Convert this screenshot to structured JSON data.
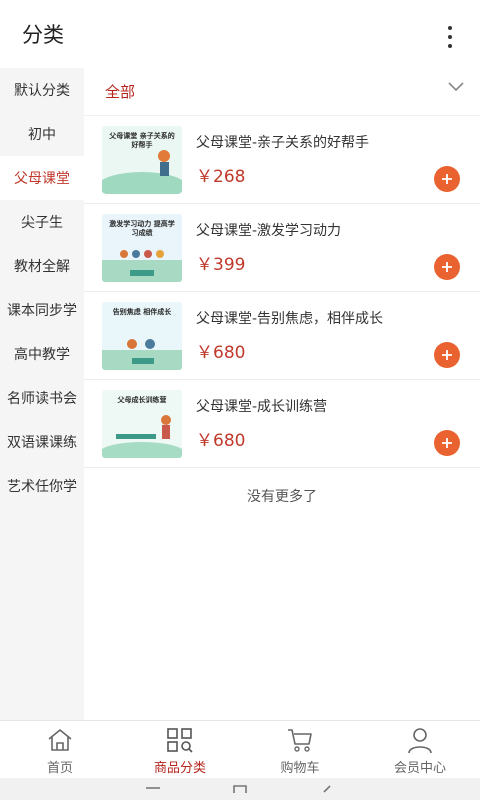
{
  "header": {
    "title": "分类"
  },
  "sidebar": {
    "items": [
      {
        "label": "默认分类"
      },
      {
        "label": "初中"
      },
      {
        "label": "父母课堂"
      },
      {
        "label": "尖子生"
      },
      {
        "label": "教材全解"
      },
      {
        "label": "课本同步学"
      },
      {
        "label": "高中教学"
      },
      {
        "label": "名师读书会"
      },
      {
        "label": "双语课课练"
      },
      {
        "label": "艺术任你学"
      }
    ],
    "active_index": 2
  },
  "filter": {
    "label": "全部"
  },
  "products": [
    {
      "name": "父母课堂-亲子关系的好帮手",
      "price": "￥268",
      "thumb_title": "父母课堂 亲子关系的好帮手"
    },
    {
      "name": "父母课堂-激发学习动力",
      "price": "￥399",
      "thumb_title": "激发学习动力 提高学习成绩"
    },
    {
      "name": "父母课堂-告别焦虑，相伴成长",
      "price": "￥680",
      "thumb_title": "告别焦虑 相伴成长"
    },
    {
      "name": "父母课堂-成长训练营",
      "price": "￥680",
      "thumb_title": "父母成长训练营"
    }
  ],
  "list_footer": "没有更多了",
  "tabbar": {
    "tabs": [
      {
        "label": "首页",
        "icon": "home-icon"
      },
      {
        "label": "商品分类",
        "icon": "category-icon"
      },
      {
        "label": "购物车",
        "icon": "cart-icon"
      },
      {
        "label": "会员中心",
        "icon": "user-icon"
      }
    ],
    "active_index": 1
  },
  "colors": {
    "accent": "#b5261e",
    "price": "#c0392b",
    "add_button": "#e9622f",
    "sidebar_bg": "#f5f5f5"
  }
}
